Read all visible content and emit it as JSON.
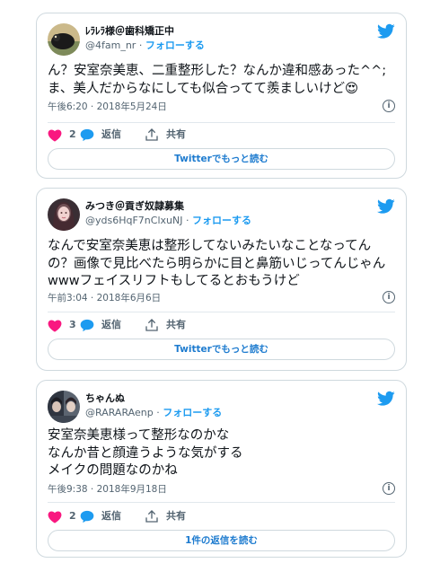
{
  "tweets": [
    {
      "display_name": "ﾚﾗﾚﾗ様＠歯科矯正中",
      "handle": "@4fam_nr",
      "follow_label": "フォローする",
      "text": "ん？安室奈美恵、二重整形した？なんか違和感あった^^;\nま、美人だからなにしても似合ってて羨ましいけど",
      "emoji": "😍",
      "timestamp": "午後6:20 · 2018年5月24日",
      "likes": "2",
      "reply_label": "返信",
      "share_label": "共有",
      "button_label": "Twitterでもっと読む"
    },
    {
      "display_name": "みつき＠貢ぎ奴隷募集",
      "handle": "@yds6HqF7nClxuNJ",
      "follow_label": "フォローする",
      "text": "なんで安室奈美恵は整形してないみたいなことなってんの？画像で見比べたら明らかに目と鼻筋いじってんじゃんwwwフェイスリフトもしてるとおもうけど",
      "timestamp": "午前3:04 · 2018年6月6日",
      "likes": "3",
      "reply_label": "返信",
      "share_label": "共有",
      "button_label": "Twitterでもっと読む"
    },
    {
      "display_name": "ちゃんぬ",
      "handle": "@RARARAenp",
      "follow_label": "フォローする",
      "text": "安室奈美恵様って整形なのかな\nなんか昔と顔違うような気がする\nメイクの問題なのかね",
      "timestamp": "午後9:38 · 2018年9月18日",
      "likes": "2",
      "reply_label": "返信",
      "share_label": "共有",
      "button_label": "1件の返信を読む"
    }
  ],
  "colors": {
    "twitter_blue": "#1d9bf0",
    "heart_pink": "#f91880",
    "text_gray": "#536471",
    "border": "#cfd9de"
  },
  "icons": {
    "brand": "twitter-bird-icon",
    "like": "heart-icon",
    "reply": "speech-bubble-icon",
    "share": "share-upload-icon",
    "info": "info-icon"
  }
}
